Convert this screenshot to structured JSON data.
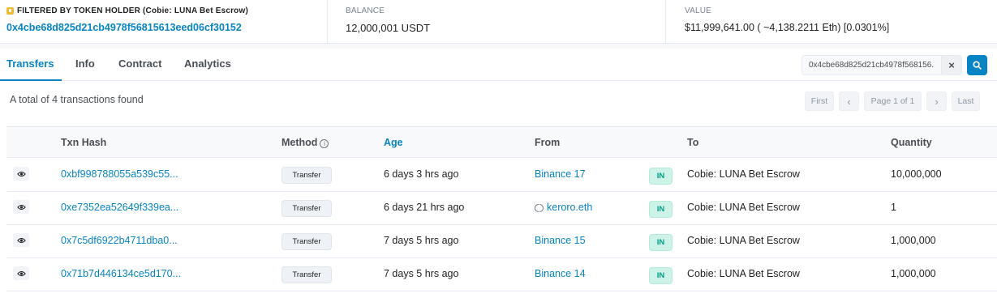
{
  "summary": {
    "filter_label": "FILTERED BY TOKEN HOLDER (Cobie: LUNA Bet Escrow)",
    "address": "0x4cbe68d825d21cb4978f56815613eed06cf30152",
    "balance_label": "BALANCE",
    "balance_value": "12,000,001 USDT",
    "value_label": "VALUE",
    "value_value": "$11,999,641.00 ( ~4,138.2211 Eth) [0.0301%]"
  },
  "tabs": [
    {
      "label": "Transfers",
      "active": true
    },
    {
      "label": "Info"
    },
    {
      "label": "Contract"
    },
    {
      "label": "Analytics"
    }
  ],
  "search": {
    "value": "0x4cbe68d825d21cb4978f568156..."
  },
  "total_text": "A total of 4 transactions found",
  "pagination": {
    "first": "First",
    "prev": "‹",
    "page": "Page 1 of 1",
    "next": "›",
    "last": "Last"
  },
  "table": {
    "headers": {
      "txn_hash": "Txn Hash",
      "method": "Method",
      "age": "Age",
      "from": "From",
      "to": "To",
      "quantity": "Quantity"
    },
    "rows": [
      {
        "hash": "0xbf998788055a539c55...",
        "method": "Transfer",
        "age": "6 days 3 hrs ago",
        "from": "Binance 17",
        "from_ens": false,
        "direction": "IN",
        "to": "Cobie: LUNA Bet Escrow",
        "quantity": "10,000,000"
      },
      {
        "hash": "0xe7352ea52649f339ea...",
        "method": "Transfer",
        "age": "6 days 21 hrs ago",
        "from": "keroro.eth",
        "from_ens": true,
        "direction": "IN",
        "to": "Cobie: LUNA Bet Escrow",
        "quantity": "1"
      },
      {
        "hash": "0x7c5df6922b4711dba0...",
        "method": "Transfer",
        "age": "7 days 5 hrs ago",
        "from": "Binance 15",
        "from_ens": false,
        "direction": "IN",
        "to": "Cobie: LUNA Bet Escrow",
        "quantity": "1,000,000"
      },
      {
        "hash": "0x71b7d446134ce5d170...",
        "method": "Transfer",
        "age": "7 days 5 hrs ago",
        "from": "Binance 14",
        "from_ens": false,
        "direction": "IN",
        "to": "Cobie: LUNA Bet Escrow",
        "quantity": "1,000,000"
      }
    ]
  },
  "icons": {
    "filter": "token-filter-icon",
    "search": "search-icon",
    "clear": "close-icon",
    "row_view": "eye-icon",
    "method_info": "info-icon",
    "ens": "ens-icon"
  },
  "colors": {
    "link": "#0784c3",
    "in_badge_bg": "#cdf2e8",
    "in_badge_text": "#00a186"
  }
}
